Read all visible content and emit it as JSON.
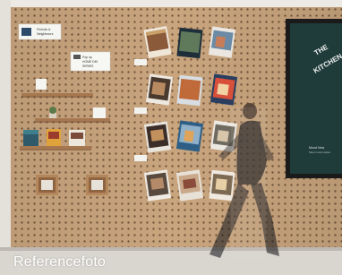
{
  "caption": "Referencefoto",
  "signs": {
    "top_left": [
      "Friends &",
      "Neighbours"
    ],
    "center_top": [
      "Pop up",
      "HOME DIN",
      "SERIES"
    ]
  },
  "screen": {
    "brand_line1": "THE",
    "brand_line2": "KITCHEN",
    "footer_title": "Mood Now",
    "footer_text": "Stop in and explore"
  },
  "colors": {
    "pegboard": "#c9a57e",
    "screen": "#1f3b3a",
    "floor": "#d9d6d0",
    "wall": "#ede9e4"
  }
}
